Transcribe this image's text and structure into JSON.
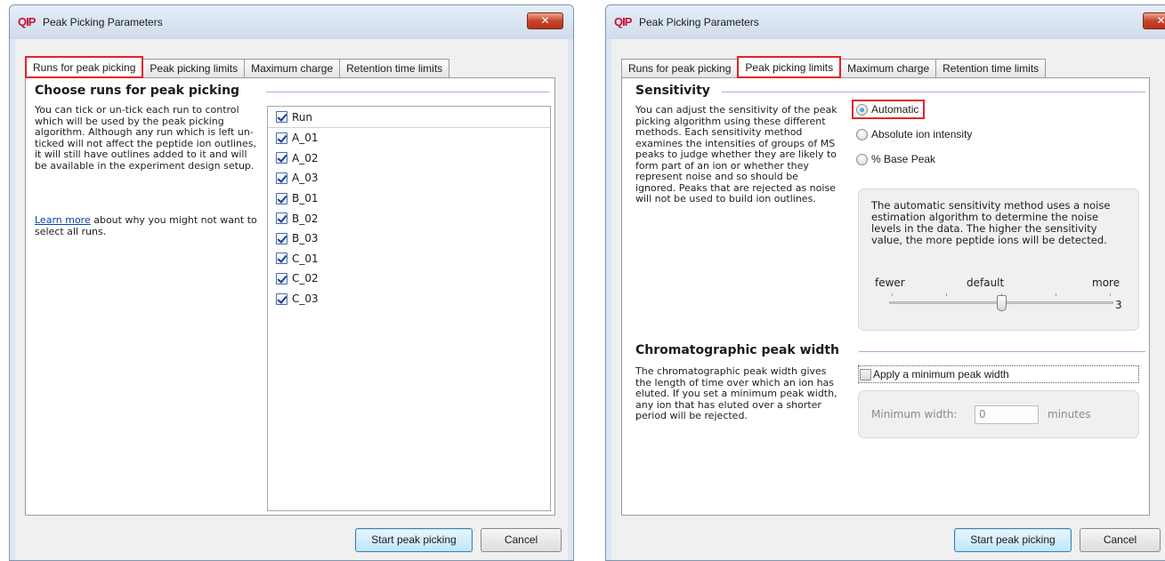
{
  "dialogs": [
    {
      "app_logo": "QIP",
      "title": "Peak Picking Parameters",
      "close_label": "✕",
      "tabs": [
        "Runs for peak picking",
        "Peak picking limits",
        "Maximum charge",
        "Retention time limits"
      ],
      "active_tab": 0,
      "section_title": "Choose runs for peak picking",
      "description": "You can tick or un-tick each run to control which will be used by the peak picking algorithm. Although any run which is left un-ticked will not affect the peptide ion outlines, it will still have outlines added to it and will be available in the experiment design setup.",
      "learn_more_link": "Learn more",
      "learn_more_text": " about why you might not want to select all runs.",
      "run_list": {
        "header": "Run",
        "header_checked": true,
        "runs": [
          {
            "name": "A_01",
            "checked": true
          },
          {
            "name": "A_02",
            "checked": true
          },
          {
            "name": "A_03",
            "checked": true
          },
          {
            "name": "B_01",
            "checked": true
          },
          {
            "name": "B_02",
            "checked": true
          },
          {
            "name": "B_03",
            "checked": true
          },
          {
            "name": "C_01",
            "checked": true
          },
          {
            "name": "C_02",
            "checked": true
          },
          {
            "name": "C_03",
            "checked": true
          }
        ]
      },
      "start_button": "Start peak picking",
      "cancel_button": "Cancel"
    },
    {
      "app_logo": "QIP",
      "title": "Peak Picking Parameters",
      "close_label": "✕",
      "tabs": [
        "Runs for peak picking",
        "Peak picking limits",
        "Maximum charge",
        "Retention time limits"
      ],
      "active_tab": 1,
      "sensitivity": {
        "title": "Sensitivity",
        "description": "You can adjust the sensitivity of the peak picking algorithm using these different methods. Each sensitivity method examines the intensities of groups of MS peaks to judge whether they are likely to form part of an ion or whether they represent noise and so should be ignored. Peaks that are rejected as noise will not be used to build ion outlines.",
        "options": [
          "Automatic",
          "Absolute ion intensity",
          "% Base Peak"
        ],
        "selected": "Automatic",
        "info": "The automatic sensitivity method uses a noise estimation algorithm to determine the noise levels in the data. The higher the sensitivity value, the more peptide ions will be detected.",
        "slider_labels": {
          "left": "fewer",
          "center": "default",
          "right": "more"
        },
        "slider_value": "3",
        "slider_min": 1,
        "slider_max": 5
      },
      "chromatographic": {
        "title": "Chromatographic peak width",
        "description": "The chromatographic peak width gives the length of time over which an ion has eluted. If you set a minimum peak width, any ion that has eluted over a shorter period will be rejected.",
        "checkbox_label": "Apply a minimum peak width",
        "checked": false,
        "min_width_label": "Minimum width:",
        "min_width_value": "0",
        "unit": "minutes"
      },
      "start_button": "Start peak picking",
      "cancel_button": "Cancel"
    }
  ]
}
